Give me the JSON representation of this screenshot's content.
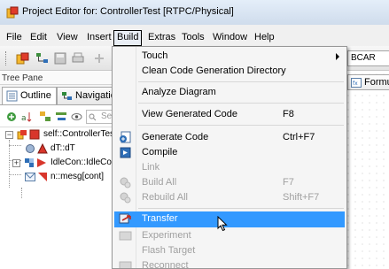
{
  "window": {
    "title": "Project Editor for: ControllerTest [RTPC/Physical]"
  },
  "menubar": {
    "items": [
      "File",
      "Edit",
      "View",
      "Insert",
      "Build",
      "Extras",
      "Tools",
      "Window",
      "Help"
    ],
    "active": "Build"
  },
  "toolbar": {
    "combo_value": "BCAR"
  },
  "tree_pane": {
    "title": "Tree Pane",
    "tabs": [
      "Outline",
      "Navigation"
    ],
    "search_placeholder": "Sea",
    "nodes": [
      "self::ControllerTest",
      "dT::dT",
      "IdleCon::IdleCon",
      "n::mesg[cont]"
    ]
  },
  "editor": {
    "tab_label": "Formu"
  },
  "build_menu": {
    "items": [
      {
        "label": "Touch",
        "shortcut": "",
        "state": "normal",
        "submenu": true,
        "icon": ""
      },
      {
        "label": "Clean Code Generation Directory",
        "shortcut": "",
        "state": "normal",
        "submenu": false,
        "icon": ""
      },
      {
        "label": "Analyze Diagram",
        "shortcut": "",
        "state": "normal",
        "submenu": false,
        "icon": ""
      },
      {
        "label": "View Generated Code",
        "shortcut": "F8",
        "state": "normal",
        "submenu": false,
        "icon": ""
      },
      {
        "label": "Generate Code",
        "shortcut": "Ctrl+F7",
        "state": "normal",
        "submenu": false,
        "icon": "generate-code-icon"
      },
      {
        "label": "Compile",
        "shortcut": "",
        "state": "normal",
        "submenu": false,
        "icon": "compile-icon"
      },
      {
        "label": "Link",
        "shortcut": "",
        "state": "disabled",
        "submenu": false,
        "icon": ""
      },
      {
        "label": "Build All",
        "shortcut": "F7",
        "state": "disabled",
        "submenu": false,
        "icon": "build-all-icon"
      },
      {
        "label": "Rebuild All",
        "shortcut": "Shift+F7",
        "state": "disabled",
        "submenu": false,
        "icon": "rebuild-all-icon"
      },
      {
        "label": "Transfer",
        "shortcut": "",
        "state": "highlighted",
        "submenu": false,
        "icon": "transfer-icon"
      },
      {
        "label": "Experiment",
        "shortcut": "",
        "state": "disabled",
        "submenu": false,
        "icon": "experiment-icon"
      },
      {
        "label": "Flash Target",
        "shortcut": "",
        "state": "disabled",
        "submenu": false,
        "icon": ""
      },
      {
        "label": "Reconnect",
        "shortcut": "",
        "state": "disabled",
        "submenu": false,
        "icon": "reconnect-icon"
      }
    ]
  },
  "colors": {
    "highlight": "#3399ff",
    "disabled_text": "#a0a0a0",
    "menu_bg": "#f5f5f5"
  }
}
